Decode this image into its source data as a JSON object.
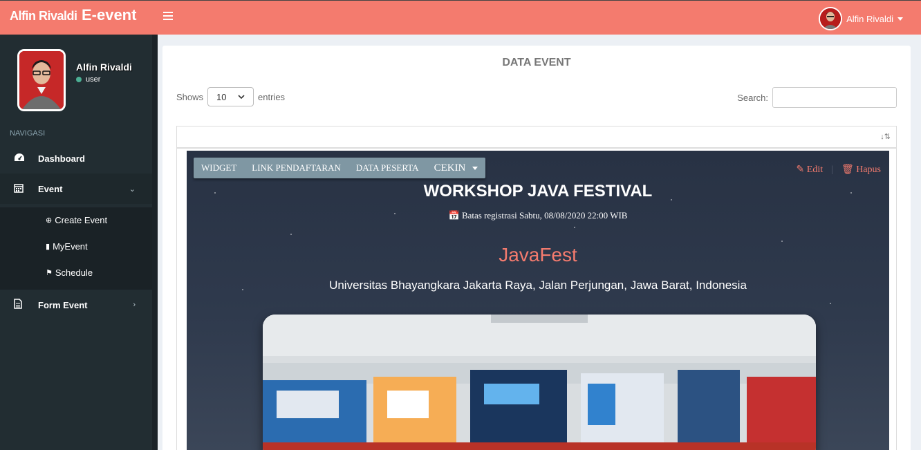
{
  "header": {
    "brand_name": "Alfin Rivaldi",
    "brand_suffix": "E-event",
    "user_name": "Alfin Rivaldi",
    "accent_color": "#f47b6e"
  },
  "sidebar": {
    "profile_name": "Alfin Rivaldi",
    "profile_role": "user",
    "nav_header": "NAVIGASI",
    "items": [
      {
        "label": "Dashboard",
        "icon": "dashboard-icon"
      },
      {
        "label": "Event",
        "icon": "calendar-icon"
      },
      {
        "label": "Form Event",
        "icon": "file-icon"
      }
    ],
    "subitems": [
      {
        "label": "Create Event",
        "icon": "plus-circle-icon"
      },
      {
        "label": "MyEvent",
        "icon": "book-icon"
      },
      {
        "label": "Schedule",
        "icon": "bookmark-icon"
      }
    ]
  },
  "main": {
    "title": "DATA EVENT",
    "shows_label": "Shows",
    "entries_value": "10",
    "entries_label": "entries",
    "search_label": "Search:",
    "search_value": ""
  },
  "event": {
    "nav": [
      "WIDGET",
      "LINK PENDAFTARAN",
      "DATA PESERTA",
      "CEKIN"
    ],
    "edit_label": "Edit",
    "delete_label": "Hapus",
    "title": "WORKSHOP JAVA FESTIVAL",
    "deadline": "Batas registrasi Sabtu, 08/08/2020 22:00 WIB",
    "name": "JavaFest",
    "location": "Universitas Bhayangkara Jakarta Raya, Jalan Perjungan, Jawa Barat, Indonesia"
  }
}
